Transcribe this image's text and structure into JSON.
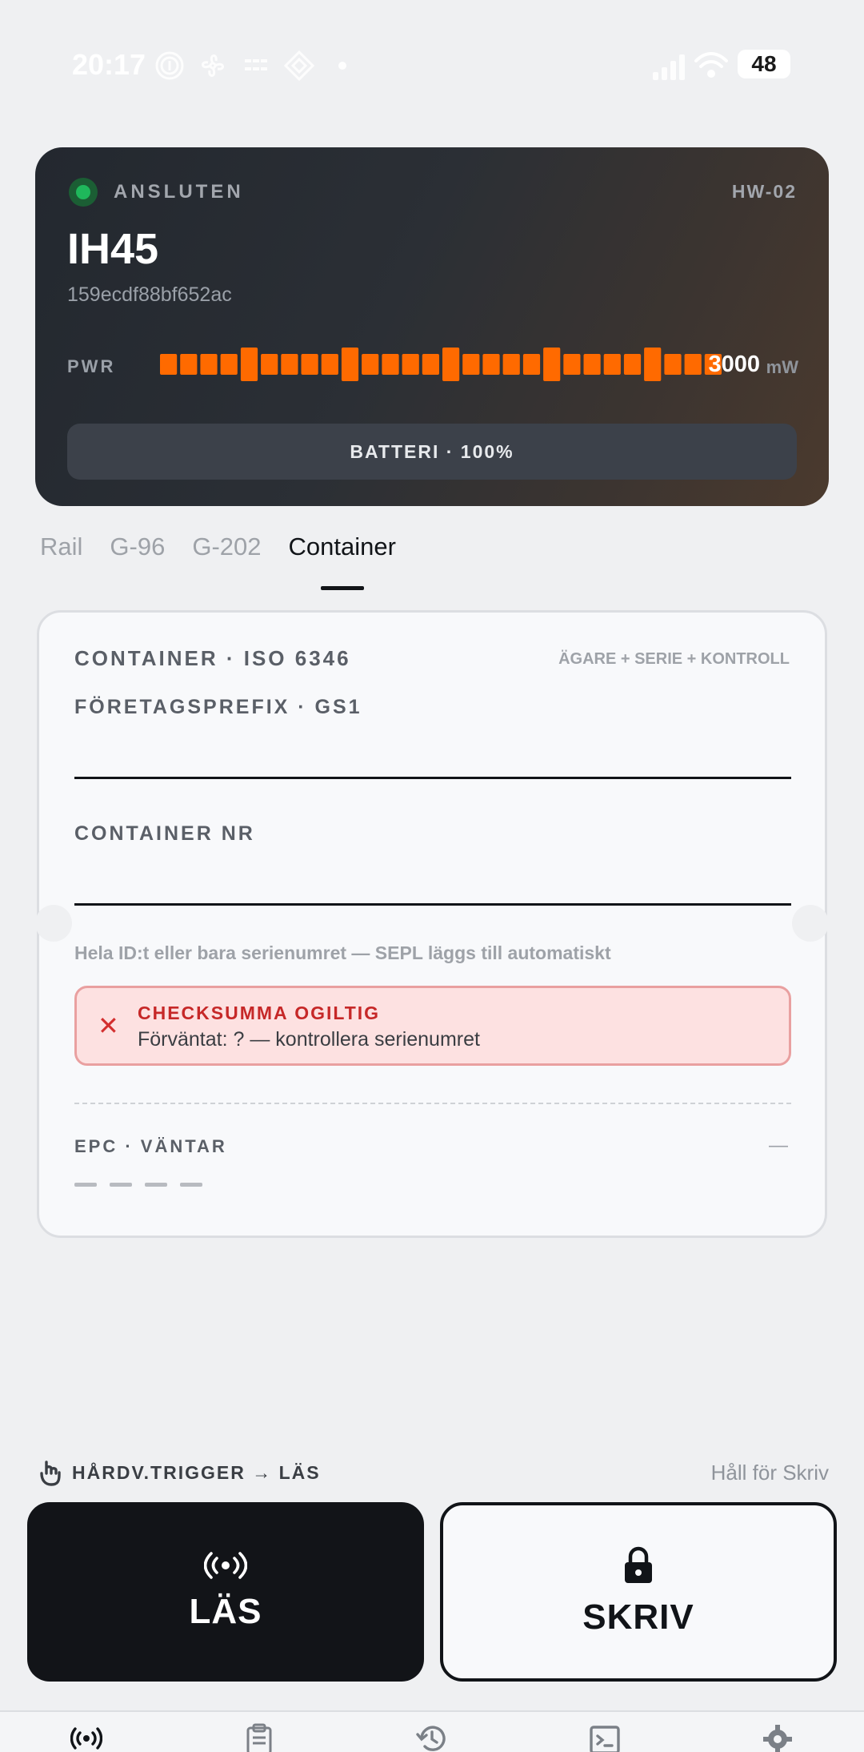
{
  "status_bar": {
    "time": "20:17",
    "battery": "48",
    "left_icons": [
      "fingerprint-icon",
      "fan-icon",
      "nfc-icon",
      "diamond-icon",
      "dot-icon"
    ],
    "right_icons": [
      "signal-icon",
      "wifi-icon",
      "battery-icon"
    ]
  },
  "device": {
    "status": "ANSLUTEN",
    "status_color": "#1fb85b",
    "hardware": "HW-02",
    "name": "IH45",
    "id": "159ecdf88bf652ac",
    "power_label": "PWR",
    "power_value": "3000",
    "power_unit": "mW",
    "power_level": 1.0,
    "power_color": "#ff6a00",
    "battery_button": "BATTERI · 100%"
  },
  "tabs": [
    {
      "label": "Rail",
      "active": false
    },
    {
      "label": "G-96",
      "active": false
    },
    {
      "label": "G-202",
      "active": false
    },
    {
      "label": "Container",
      "active": true
    }
  ],
  "container_card": {
    "title": "CONTAINER · ISO 6346",
    "hint": "ÄGARE + SERIE + KONTROLL",
    "prefix_label": "FÖRETAGSPREFIX · GS1",
    "prefix_value": "",
    "number_label": "CONTAINER NR",
    "number_value": "",
    "helper": "Hela ID:t eller bara serienumret — SEPL läggs till automatiskt",
    "error_title": "CHECKSUMMA OGILTIG",
    "error_text": "Förväntat: ? — kontrollera serienumret",
    "error_color": "#c62828",
    "epc_label": "EPC · VÄNTAR",
    "epc_value": "—"
  },
  "trigger": {
    "label": "HÅRDV.TRIGGER → LÄS",
    "hint": "Håll för Skriv"
  },
  "actions": {
    "read_label": "LÄS",
    "write_label": "SKRIV"
  },
  "bottom_nav": {
    "items": [
      "radio-tab-icon",
      "clipboard-tab-icon",
      "history-tab-icon",
      "terminal-tab-icon",
      "settings-tab-icon"
    ]
  }
}
